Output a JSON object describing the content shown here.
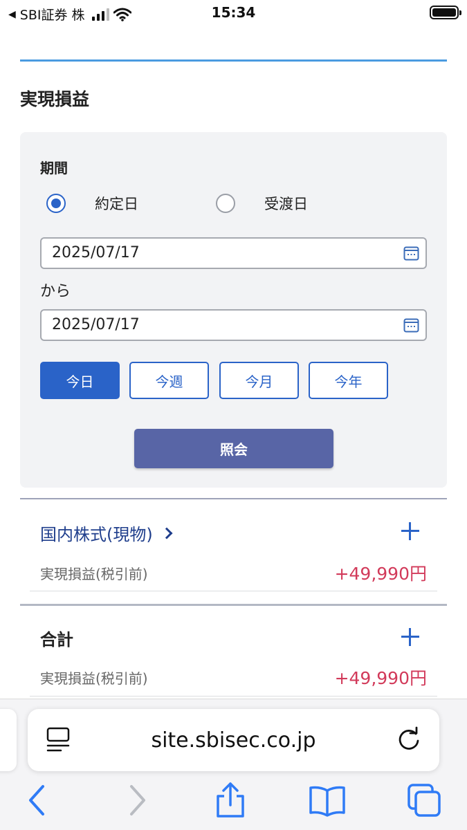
{
  "status_bar": {
    "back_marker": "◀",
    "carrier": "SBI証券 株",
    "time": "15:34"
  },
  "page": {
    "title": "実現損益"
  },
  "filter": {
    "period_label": "期間",
    "radio_options": [
      {
        "label": "約定日",
        "checked": true
      },
      {
        "label": "受渡日",
        "checked": false
      }
    ],
    "from_date": "2025/07/17",
    "from_label": "から",
    "to_date": "2025/07/17",
    "range_buttons": [
      {
        "label": "今日",
        "active": true
      },
      {
        "label": "今週",
        "active": false
      },
      {
        "label": "今月",
        "active": false
      },
      {
        "label": "今年",
        "active": false
      }
    ],
    "query_label": "照会"
  },
  "results": {
    "domestic": {
      "title": "国内株式(現物)",
      "row_label": "実現損益(税引前)",
      "row_value": "+49,990円"
    },
    "total": {
      "title": "合計",
      "row_label": "実現損益(税引前)",
      "row_value": "+49,990円"
    }
  },
  "browser": {
    "url": "site.sbisec.co.jp",
    "toolbar_icons": [
      "back-icon",
      "forward-icon",
      "share-icon",
      "bookmarks-icon",
      "tabs-icon"
    ]
  },
  "colors": {
    "accent": "#2a63c8",
    "query_button": "#5865a6",
    "profit": "#d23a5a",
    "link": "#1f3e8c",
    "top_rule": "#4a9be0"
  }
}
